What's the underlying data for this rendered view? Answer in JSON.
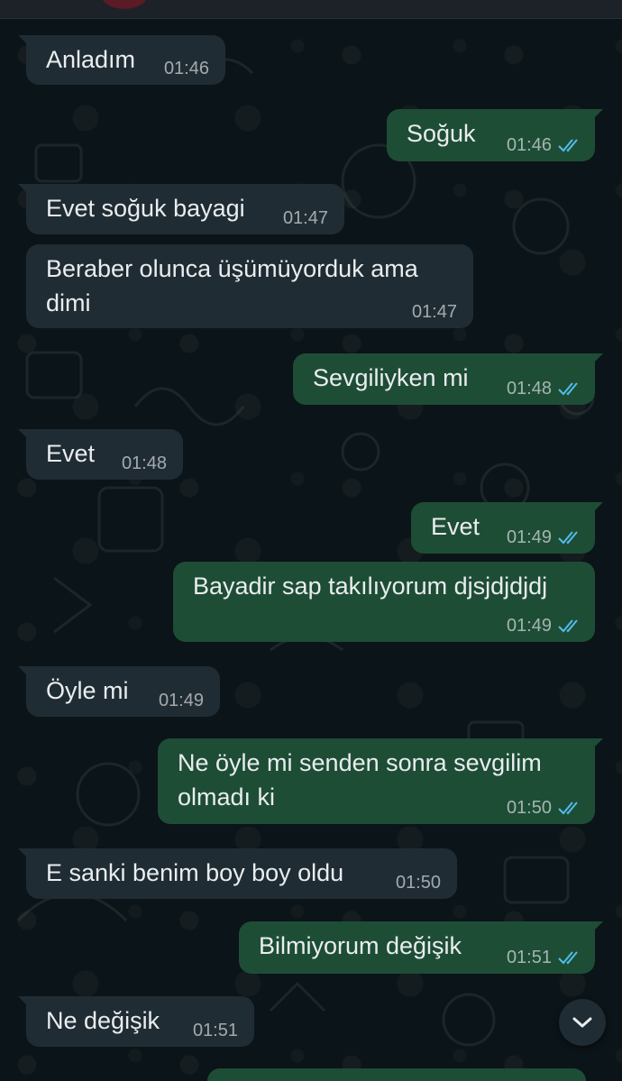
{
  "messages": [
    {
      "direction": "in",
      "text": "Anladım",
      "time": "01:46"
    },
    {
      "direction": "out",
      "text": "Soğuk",
      "time": "01:46",
      "read": true
    },
    {
      "direction": "in",
      "text": "Evet soğuk bayagi",
      "time": "01:47"
    },
    {
      "direction": "in",
      "text": "Beraber olunca üşümüyorduk ama\ndimi",
      "time": "01:47"
    },
    {
      "direction": "out",
      "text": "Sevgiliyken mi",
      "time": "01:48",
      "read": true
    },
    {
      "direction": "in",
      "text": "Evet",
      "time": "01:48"
    },
    {
      "direction": "out",
      "text": "Evet",
      "time": "01:49",
      "read": true
    },
    {
      "direction": "out",
      "text": "Bayadir sap takılıyorum djsjdjdjdj",
      "time": "01:49",
      "read": true
    },
    {
      "direction": "in",
      "text": "Öyle mi",
      "time": "01:49"
    },
    {
      "direction": "out",
      "text": "Ne öyle mi senden sonra sevgilim\nolmadı ki",
      "time": "01:50",
      "read": true
    },
    {
      "direction": "in",
      "text": "E sanki benim boy boy oldu",
      "time": "01:50"
    },
    {
      "direction": "out",
      "text": "Bilmiyorum değişik",
      "time": "01:51",
      "read": true
    },
    {
      "direction": "in",
      "text": "Ne değişik",
      "time": "01:51"
    }
  ],
  "icons": {
    "read_receipt": "double-check-icon",
    "scroll_down": "chevron-down-icon"
  },
  "colors": {
    "background": "#0b1418",
    "incoming_bubble": "#202c33",
    "outgoing_bubble": "#1e4d36",
    "read_tick": "#53bdeb",
    "text": "#e9edef"
  }
}
